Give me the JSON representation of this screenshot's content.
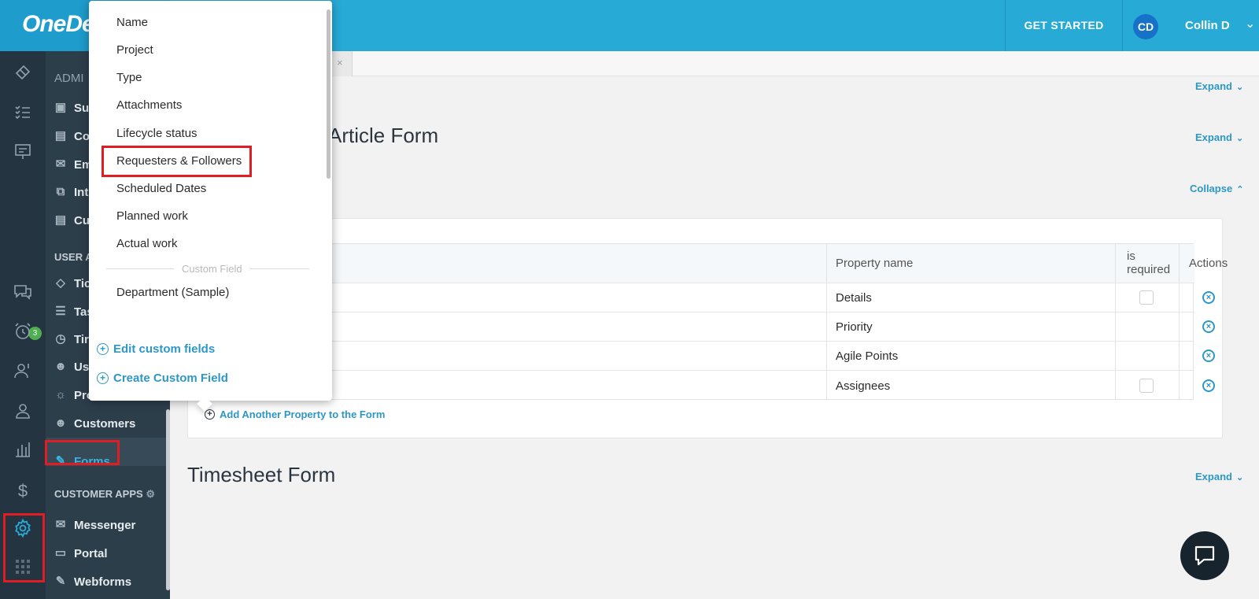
{
  "header": {
    "logo": "OneDe",
    "get_started": "GET STARTED",
    "avatar_initials": "CD",
    "username": "Collin D"
  },
  "rail": {
    "badge_count": "3"
  },
  "subnav": {
    "admin_head": "ADMI",
    "admin_items": [
      "Sul",
      "Co",
      "Em",
      "Int",
      "Cu"
    ],
    "user_apps_head": "USER A",
    "user_items": [
      "Tic",
      "Tas",
      "Tir",
      "Us",
      "Pro"
    ],
    "customers": "Customers",
    "forms": "Forms",
    "customer_apps_head": "CUSTOMER APPS",
    "messenger": "Messenger",
    "portal": "Portal",
    "webforms": "Webforms"
  },
  "main": {
    "tab_close": "×",
    "section1_toggle": "Expand",
    "section2_title": "Article Form",
    "section2_toggle": "Expand",
    "section3_toggle": "Collapse",
    "table": {
      "headers": [
        "Property name",
        "is required",
        "Actions"
      ],
      "rows": [
        {
          "name": "Details"
        },
        {
          "name": "Priority"
        },
        {
          "name": "Agile Points"
        },
        {
          "name": "Assignees"
        }
      ]
    },
    "add_property": "Add Another Property to the Form",
    "timesheet_title": "Timesheet Form",
    "timesheet_toggle": "Expand"
  },
  "dropdown": {
    "items": [
      "Name",
      "Project",
      "Type",
      "Attachments",
      "Lifecycle status",
      "Requesters & Followers",
      "Scheduled Dates",
      "Planned work",
      "Actual work"
    ],
    "custom_field_label": "Custom Field",
    "custom_items": [
      "Department (Sample)"
    ],
    "edit_custom_fields": "Edit custom fields",
    "create_custom_field": "Create Custom Field"
  },
  "colors": {
    "header_blue": "#27aad6",
    "sidebar_dark": "#243440",
    "highlight_red": "#e11d24",
    "link_blue": "#2d97c6"
  }
}
